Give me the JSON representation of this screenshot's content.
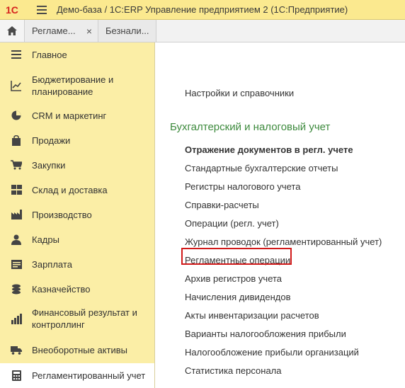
{
  "titlebar": {
    "logo": "1С",
    "title": "Демо-база / 1С:ERP Управление предприятием 2  (1С:Предприятие)"
  },
  "tabs": [
    {
      "label": "Регламе...",
      "close": "×"
    },
    {
      "label": "Безнали..."
    }
  ],
  "sidebar": {
    "items": [
      {
        "label": "Главное",
        "icon": "list-icon"
      },
      {
        "label": "Бюджетирование и планирование",
        "icon": "chart-icon"
      },
      {
        "label": "CRM и маркетинг",
        "icon": "pie-icon"
      },
      {
        "label": "Продажи",
        "icon": "bag-icon"
      },
      {
        "label": "Закупки",
        "icon": "cart-icon"
      },
      {
        "label": "Склад и доставка",
        "icon": "warehouse-icon"
      },
      {
        "label": "Производство",
        "icon": "factory-icon"
      },
      {
        "label": "Кадры",
        "icon": "person-icon"
      },
      {
        "label": "Зарплата",
        "icon": "payroll-icon"
      },
      {
        "label": "Казначейство",
        "icon": "coins-icon"
      },
      {
        "label": "Финансовый результат и контроллинг",
        "icon": "finance-icon"
      },
      {
        "label": "Внеоборотные активы",
        "icon": "truck-icon"
      },
      {
        "label": "Регламентированный учет",
        "icon": "calculator-icon"
      }
    ]
  },
  "main": {
    "settings_link": "Настройки и справочники",
    "section_title": "Бухгалтерский и налоговый учет",
    "links": [
      "Отражение документов в регл. учете",
      "Стандартные бухгалтерские отчеты",
      "Регистры налогового учета",
      "Справки-расчеты",
      "Операции (регл. учет)",
      "Журнал проводок (регламентированный учет)",
      "Регламентные операции",
      "Архив регистров учета",
      "Начисления дивидендов",
      "Акты инвентаризации расчетов",
      "Варианты налогообложения прибыли",
      "Налогообложение прибыли организаций",
      "Статистика персонала"
    ]
  },
  "colors": {
    "sidebar_bg": "#fbeea6",
    "titlebar_bg": "#fbe98f",
    "section_title": "#3d8a3d",
    "highlight_border": "#d11a1a"
  }
}
